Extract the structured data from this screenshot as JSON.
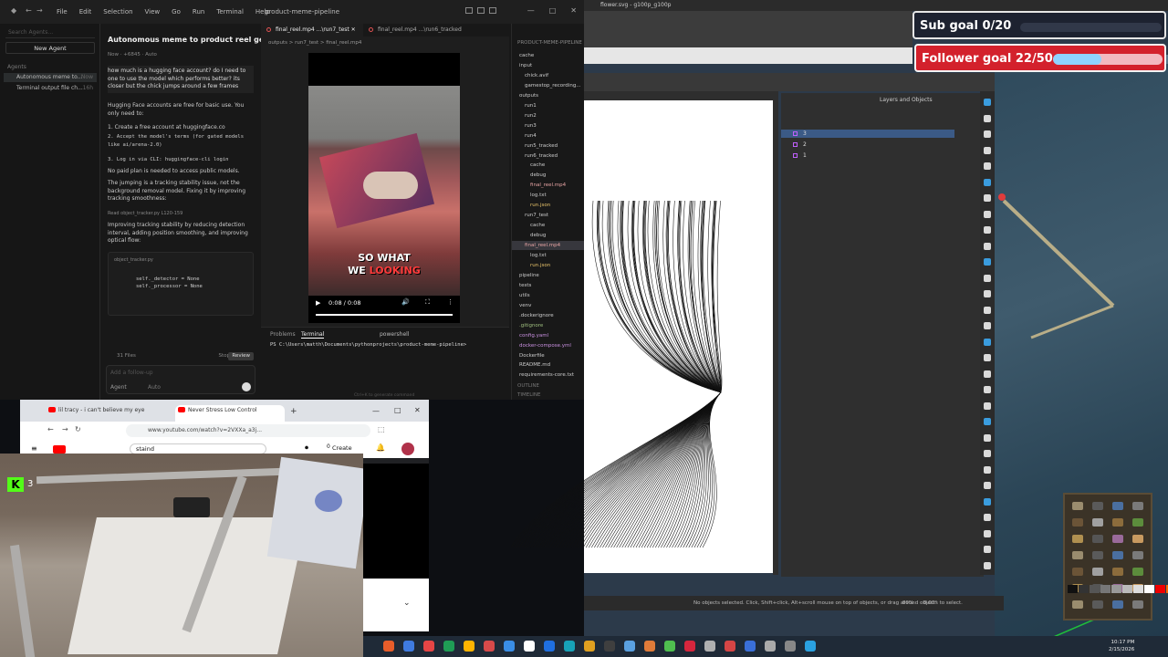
{
  "ide": {
    "menu": [
      "File",
      "Edit",
      "Selection",
      "View",
      "Go",
      "Run",
      "Terminal",
      "Help"
    ],
    "title": "product-meme-pipeline"
  },
  "agents": {
    "search_placeholder": "Search Agents...",
    "new_agent": "New Agent",
    "section": "Agents",
    "items": [
      {
        "label": "Autonomous meme to...",
        "time": "Now"
      },
      {
        "label": "Terminal output file ch...",
        "time": "16h"
      }
    ]
  },
  "chat": {
    "title": "Autonomous meme to product reel gene...",
    "meta": "Now · +6845 · Auto",
    "user_msg": "how much is a hugging face account? do I need to one to use the model which performs better? its closer but the chick jumps around a few frames",
    "reply_intro": "Hugging Face accounts are free for basic use. You only need to:",
    "step1": "1. Create a free account at huggingface.co",
    "step2": "2. Accept the model's terms (for gated models like ai/arena-2.0)",
    "step3": "3. Log in via CLI: huggingface-cli login",
    "no_paid": "No paid plan is needed to access public models.",
    "jumping": "The jumping is a tracking stability issue, not the background removal model. Fixing it by improving tracking smoothness:",
    "read": "Read object_tracker.py L120-159",
    "improving": "Improving tracking stability by reducing detection interval, adding position smoothing, and improving optical flow:",
    "code_file": "object_tracker.py",
    "code_line1": "self._detector = None",
    "code_line2": "self._processor = None",
    "files": "31 Files",
    "stop": "Stop",
    "review": "Review",
    "input_placeholder": "Add a follow-up",
    "mode": "Agent",
    "model": "Auto"
  },
  "editor": {
    "tabs": [
      "final_reel.mp4 ...\\run7_test",
      "final_reel.mp4 ...\\run6_tracked"
    ],
    "breadcrumb": "outputs > run7_test > final_reel.mp4",
    "video_time": "0:08 / 0:08",
    "caption_line1": "SO WHAT",
    "caption_we": "WE",
    "caption_looking": "LOOKING"
  },
  "panel": {
    "tabs": [
      "Problems",
      "Terminal"
    ],
    "shell": "powershell",
    "prompt": "PS C:\\Users\\matth\\Documents\\pythonprojects\\product-meme-pipeline>",
    "hint": "Ctrl+K to generate command"
  },
  "explorer": {
    "head": "PRODUCT-MEME-PIPELINE",
    "rows": [
      {
        "label": "cache",
        "indent": 8,
        "cls": ""
      },
      {
        "label": "input",
        "indent": 8,
        "cls": ""
      },
      {
        "label": "chick.avif",
        "indent": 14,
        "cls": ""
      },
      {
        "label": "gamestop_recording...",
        "indent": 14,
        "cls": ""
      },
      {
        "label": "outputs",
        "indent": 8,
        "cls": ""
      },
      {
        "label": "run1",
        "indent": 14,
        "cls": ""
      },
      {
        "label": "run2",
        "indent": 14,
        "cls": ""
      },
      {
        "label": "run3",
        "indent": 14,
        "cls": ""
      },
      {
        "label": "run4",
        "indent": 14,
        "cls": ""
      },
      {
        "label": "run5_tracked",
        "indent": 14,
        "cls": ""
      },
      {
        "label": "run6_tracked",
        "indent": 14,
        "cls": ""
      },
      {
        "label": "cache",
        "indent": 20,
        "cls": ""
      },
      {
        "label": "debug",
        "indent": 20,
        "cls": ""
      },
      {
        "label": "final_reel.mp4",
        "indent": 20,
        "cls": "mp4"
      },
      {
        "label": "log.txt",
        "indent": 20,
        "cls": ""
      },
      {
        "label": "run.json",
        "indent": 20,
        "cls": "json"
      },
      {
        "label": "run7_test",
        "indent": 14,
        "cls": ""
      },
      {
        "label": "cache",
        "indent": 20,
        "cls": ""
      },
      {
        "label": "debug",
        "indent": 20,
        "cls": ""
      },
      {
        "label": "final_reel.mp4",
        "indent": 20,
        "cls": "mp4 hl"
      },
      {
        "label": "log.txt",
        "indent": 20,
        "cls": ""
      },
      {
        "label": "run.json",
        "indent": 20,
        "cls": "json"
      },
      {
        "label": "pipeline",
        "indent": 8,
        "cls": ""
      },
      {
        "label": "tests",
        "indent": 8,
        "cls": ""
      },
      {
        "label": "utils",
        "indent": 8,
        "cls": ""
      },
      {
        "label": "venv",
        "indent": 8,
        "cls": ""
      },
      {
        "label": ".dockerignore",
        "indent": 8,
        "cls": ""
      },
      {
        "label": ".gitignore",
        "indent": 8,
        "cls": "git"
      },
      {
        "label": "config.yaml",
        "indent": 8,
        "cls": "yaml"
      },
      {
        "label": "docker-compose.yml",
        "indent": 8,
        "cls": "yaml"
      },
      {
        "label": "Dockerfile",
        "indent": 8,
        "cls": ""
      },
      {
        "label": "README.md",
        "indent": 8,
        "cls": ""
      },
      {
        "label": "requirements-core.txt",
        "indent": 8,
        "cls": ""
      }
    ],
    "footer1": "OUTLINE",
    "footer2": "TIMELINE"
  },
  "inkscape": {
    "title": "flower.svg - g100p_g100p",
    "layers_tab": "Layers and Objects",
    "layers": [
      "3",
      "2",
      "1"
    ],
    "status": "No objects selected. Click, Shift+click, Alt+scroll mouse on top of objects, or drag around objects to select.",
    "zoom": "89%",
    "rotation": "0.00°"
  },
  "overlay": {
    "sub_goal": "Sub goal 0/20",
    "sub_progress": 0.0,
    "follower_goal": "Follower goal 22/50",
    "follower_progress": 0.44
  },
  "browser": {
    "tabs": [
      "lil tracy - i can't believe my eye",
      "Never Stress Low Control"
    ],
    "url": "www.youtube.com/watch?v=2VXXa_a3j...",
    "search_text": "staind",
    "create": "Create",
    "notif_count": "0"
  },
  "webcam": {
    "kick_count": "3"
  },
  "taskbar": {
    "time": "10:17 PM",
    "date": "2/15/2026"
  },
  "colors": {
    "accent": "#3b5a86",
    "follower_bar": "#8fd3ff",
    "follower_bg": "#d3212c",
    "kick_green": "#53fc18"
  }
}
